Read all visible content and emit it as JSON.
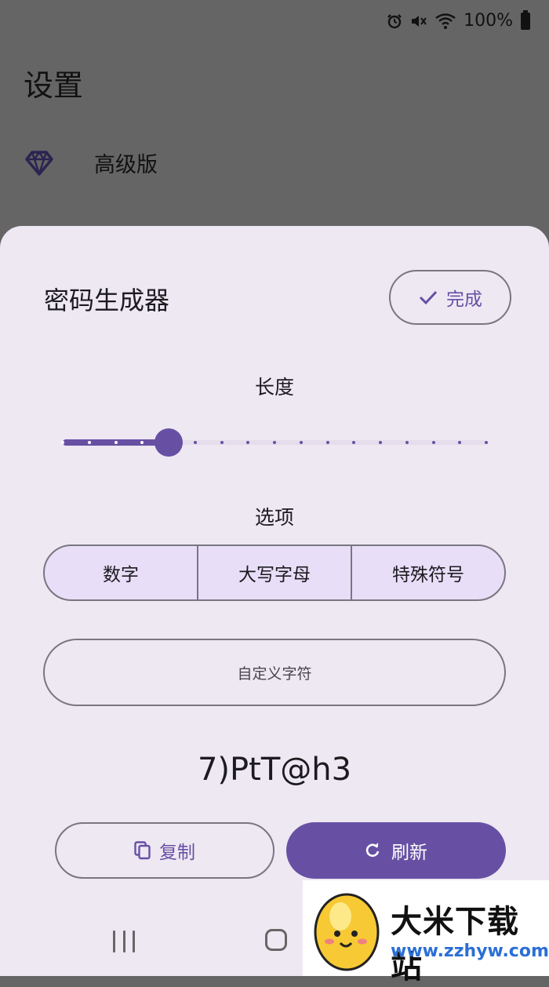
{
  "status_bar": {
    "battery_text": "100%",
    "icons": [
      "alarm-icon",
      "mute-icon",
      "wifi-icon",
      "battery-icon"
    ]
  },
  "background": {
    "title": "设置",
    "item": {
      "icon": "diamond-icon",
      "label": "高级版"
    }
  },
  "sheet": {
    "title": "密码生成器",
    "done_label": "完成",
    "length_label": "长度",
    "length_slider": {
      "min_step": 0,
      "max_step": 16,
      "current_step": 4
    },
    "options_label": "选项",
    "options": [
      "数字",
      "大写字母",
      "特殊符号"
    ],
    "custom_placeholder": "自定义字符",
    "password": "7)PtT@h3",
    "copy_label": "复制",
    "refresh_label": "刷新"
  },
  "watermark": {
    "title": "大米下载站",
    "url": "www.zzhyw.com"
  },
  "colors": {
    "accent": "#6750A4",
    "sheet_bg": "#EEE8F3",
    "scrim": "#666566"
  }
}
